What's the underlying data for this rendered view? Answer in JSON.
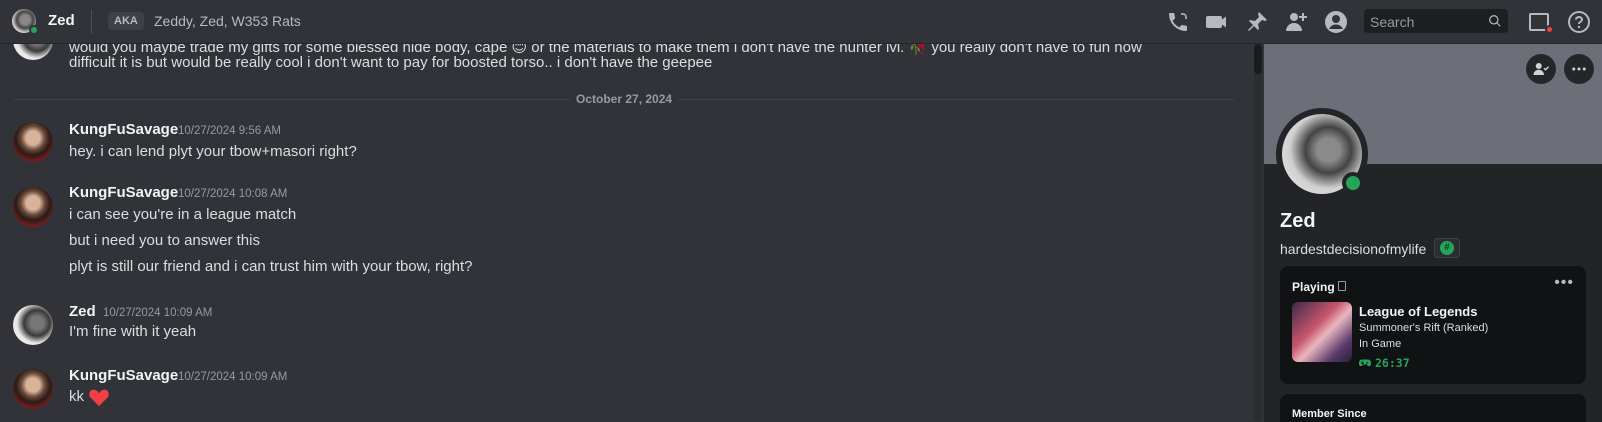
{
  "header": {
    "name": "Zed",
    "aka_label": "AKA",
    "aka_names": "Zeddy, Zed, W353 Rats",
    "search_placeholder": "Search",
    "icons": [
      "voice-call-icon",
      "video-call-icon",
      "pin-icon",
      "add-friends-to-dm-icon",
      "user-profile-icon",
      "inbox-icon",
      "help-icon"
    ]
  },
  "chat": {
    "clipped_top_line": "would you maybe trade my gifts for some blessed hide body, cape 😊 or the materials to make them i don't have the hunter lvl. 🥀 you really don't have to fuh how",
    "prev_line": "difficult it is but would be really cool i don't want to pay for boosted torso.. i don't have the geepee",
    "date_divider": "October 27, 2024",
    "messages": [
      {
        "author": "KungFuSavage",
        "timestamp": "10/27/2024 9:56 AM",
        "lines": [
          "hey. i can lend plyt your tbow+masori right?"
        ]
      },
      {
        "author": "KungFuSavage",
        "timestamp": "10/27/2024 10:08 AM",
        "lines": [
          "i can see you're in a league match",
          "but i need you to answer this",
          "plyt is still our friend and i can trust him with your tbow, right?"
        ]
      },
      {
        "author": "Zed",
        "timestamp": "10/27/2024 10:09 AM",
        "lines": [
          "I'm fine with it yeah"
        ]
      },
      {
        "author": "KungFuSavage",
        "timestamp": "10/27/2024 10:09 AM",
        "lines": [
          "kk"
        ]
      }
    ]
  },
  "profile": {
    "display_name": "Zed",
    "username": "hardestdecisionofmylife",
    "activity": {
      "heading": "Playing",
      "game": "League of Legends",
      "details": "Summoner's Rift (Ranked)",
      "state": "In Game",
      "elapsed": "26:37"
    },
    "member_since_label": "Member Since"
  },
  "colors": {
    "online": "#23a55a",
    "background": "#313338",
    "panel": "#232428",
    "heart": "#f23f43"
  }
}
